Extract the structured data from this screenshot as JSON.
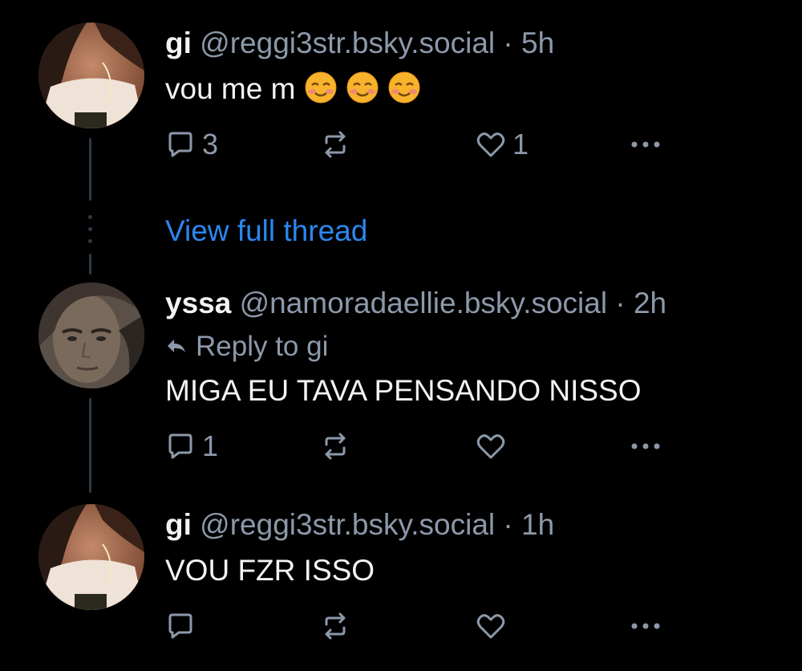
{
  "posts": [
    {
      "name": "gi",
      "handle": "@reggi3str.bsky.social",
      "separator": "·",
      "time": "5h",
      "text": "vou me m",
      "emoji": [
        "smiling-face-emoji",
        "smiling-face-emoji",
        "smiling-face-emoji"
      ],
      "actions": {
        "replies": "3",
        "reposts": "",
        "likes": "1"
      }
    },
    {
      "name": "yssa",
      "handle": "@namoradaellie.bsky.social",
      "separator": "·",
      "time": "2h",
      "reply_to": "Reply to gi",
      "text": "MIGA EU TAVA PENSANDO NISSO",
      "actions": {
        "replies": "1",
        "reposts": "",
        "likes": ""
      }
    },
    {
      "name": "gi",
      "handle": "@reggi3str.bsky.social",
      "separator": "·",
      "time": "1h",
      "text": "VOU FZR ISSO",
      "actions": {
        "replies": "",
        "reposts": "",
        "likes": ""
      }
    }
  ],
  "thread_link": "View full thread",
  "colors": {
    "background": "#000000",
    "text": "#f1f3f5",
    "muted": "#8c99aa",
    "link": "#2c87f0",
    "thread_line": "#2e3a49"
  },
  "icons": [
    "reply-icon",
    "repost-icon",
    "like-icon",
    "more-icon",
    "reply-arrow-icon"
  ]
}
